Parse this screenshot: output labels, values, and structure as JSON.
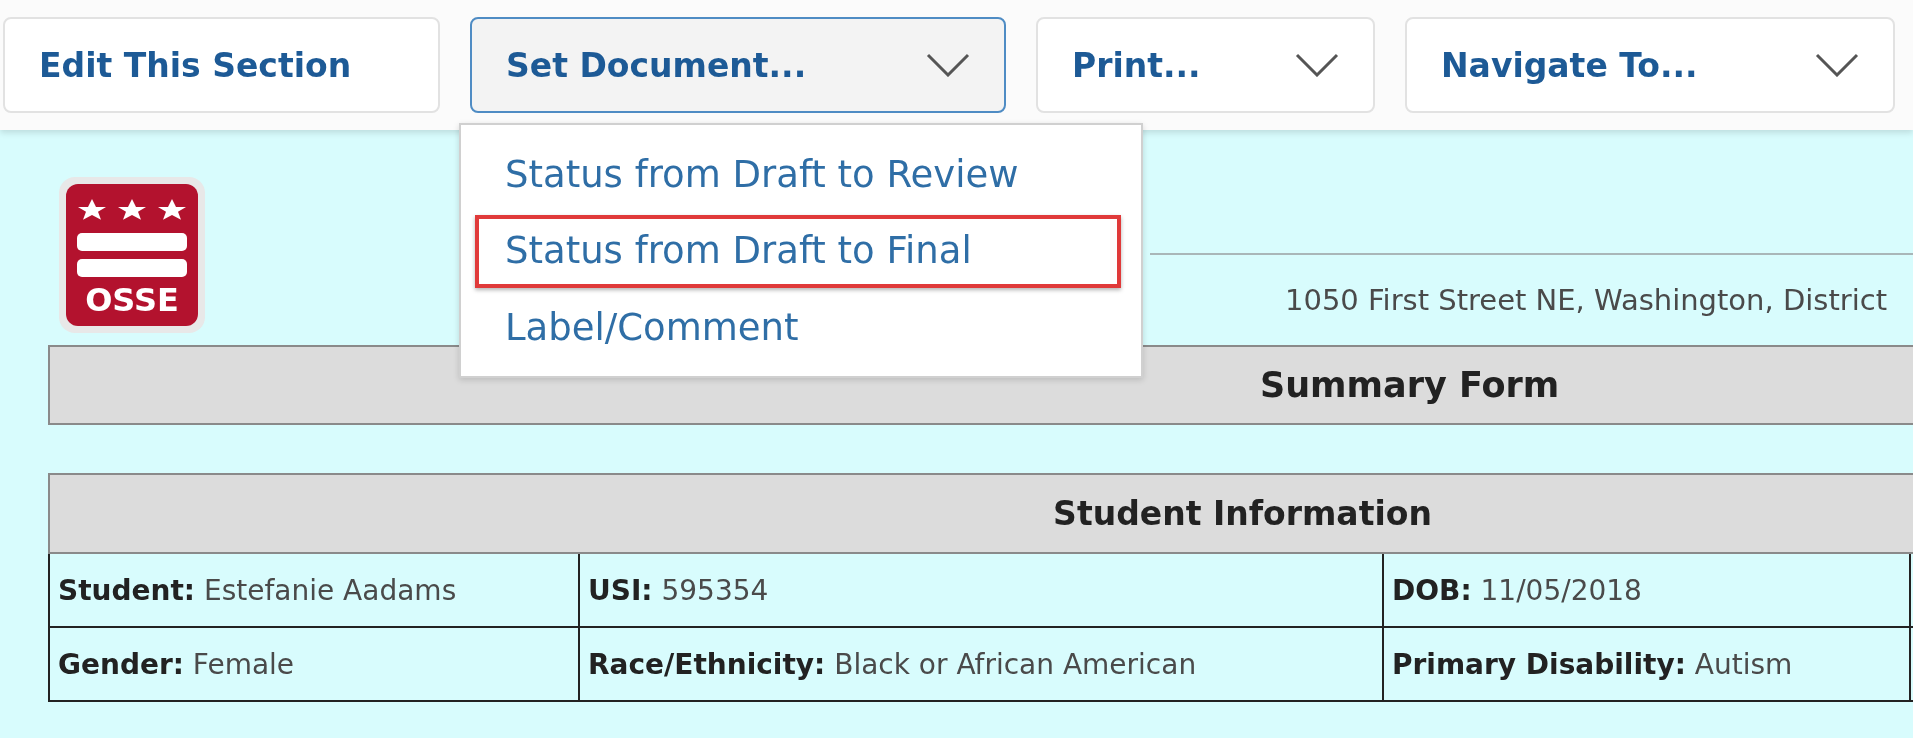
{
  "toolbar": {
    "buttons": [
      {
        "label": "Edit This Section",
        "kind": "plain",
        "expanded": false
      },
      {
        "label": "Set Document...",
        "kind": "dropdown",
        "expanded": true
      },
      {
        "label": "Print...",
        "kind": "dropdown",
        "expanded": false
      },
      {
        "label": "Navigate To...",
        "kind": "dropdown",
        "expanded": false
      }
    ]
  },
  "menu": {
    "items": [
      {
        "label": "Status from Draft to Review",
        "highlighted": false
      },
      {
        "label": "Status from Draft to Final",
        "highlighted": true
      },
      {
        "label": "Label/Comment",
        "highlighted": false
      }
    ]
  },
  "header": {
    "address": "1050 First Street NE, Washington, District"
  },
  "logo_text": "OSSE",
  "form_title": "Summary Form",
  "section": {
    "title": "Student Information",
    "rows": [
      [
        {
          "label": "Student:",
          "value": "Estefanie Aadams"
        },
        {
          "label": "USI:",
          "value": "595354"
        },
        {
          "label": "DOB:",
          "value": "11/05/2018"
        }
      ],
      [
        {
          "label": "Gender:",
          "value": "Female"
        },
        {
          "label": "Race/Ethnicity:",
          "value": "Black or African American"
        },
        {
          "label": "Primary Disability:",
          "value": "Autism"
        }
      ]
    ]
  }
}
